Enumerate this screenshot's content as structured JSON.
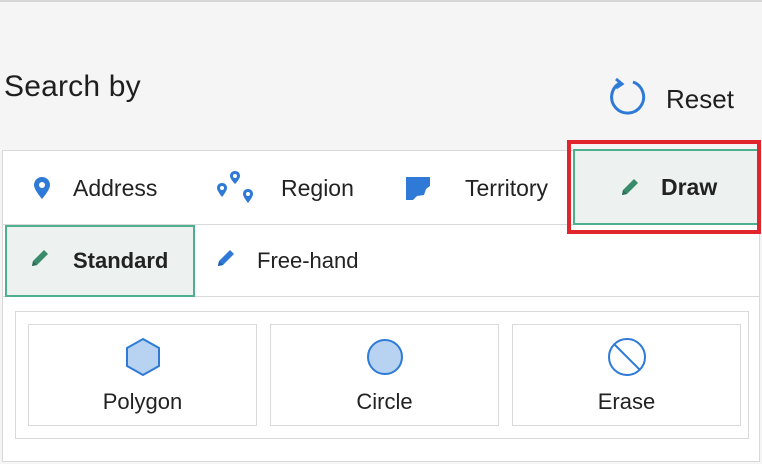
{
  "header": {
    "title": "Search by"
  },
  "reset": {
    "label": "Reset",
    "icon": "refresh-icon"
  },
  "tabs": [
    {
      "label": "Address",
      "icon": "map-pin-icon"
    },
    {
      "label": "Region",
      "icon": "multi-pin-icon"
    },
    {
      "label": "Territory",
      "icon": "territory-shape-icon"
    },
    {
      "label": "Draw",
      "icon": "pencil-icon",
      "selected": true
    }
  ],
  "subtabs": [
    {
      "label": "Standard",
      "icon": "pencil-icon",
      "selected": true
    },
    {
      "label": "Free-hand",
      "icon": "pencil-icon"
    }
  ],
  "tools": [
    {
      "label": "Polygon",
      "icon": "hexagon-icon"
    },
    {
      "label": "Circle",
      "icon": "circle-icon"
    },
    {
      "label": "Erase",
      "icon": "erase-icon"
    }
  ],
  "colors": {
    "accent_blue": "#2f7ad6",
    "selected_border": "#4fb08f",
    "selected_bg": "#edf2f1",
    "highlight": "#e0262c"
  }
}
